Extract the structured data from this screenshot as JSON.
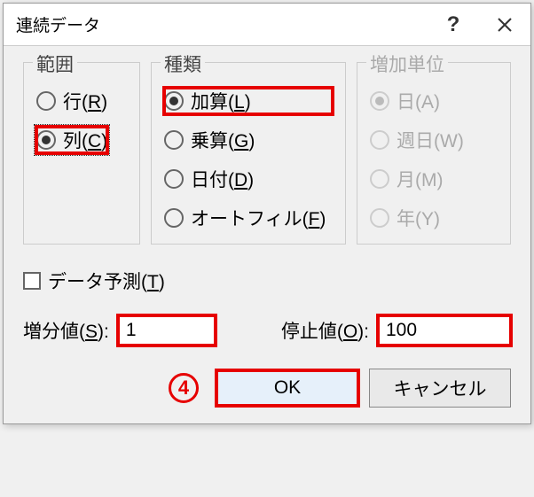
{
  "title": "連続データ",
  "help_label": "?",
  "groups": {
    "range": {
      "label": "範囲",
      "options": [
        {
          "label_pre": "行(",
          "mnemonic": "R",
          "label_post": ")",
          "selected": false
        },
        {
          "label_pre": "列(",
          "mnemonic": "C",
          "label_post": ")",
          "selected": true
        }
      ]
    },
    "type": {
      "label": "種類",
      "options": [
        {
          "label_pre": "加算(",
          "mnemonic": "L",
          "label_post": ")",
          "selected": true
        },
        {
          "label_pre": "乗算(",
          "mnemonic": "G",
          "label_post": ")",
          "selected": false
        },
        {
          "label_pre": "日付(",
          "mnemonic": "D",
          "label_post": ")",
          "selected": false
        },
        {
          "label_pre": "オートフィル(",
          "mnemonic": "F",
          "label_post": ")",
          "selected": false
        }
      ]
    },
    "unit": {
      "label": "増加単位",
      "options": [
        {
          "label_pre": "日(",
          "mnemonic": "A",
          "label_post": ")",
          "selected": true
        },
        {
          "label_pre": "週日(",
          "mnemonic": "W",
          "label_post": ")",
          "selected": false
        },
        {
          "label_pre": "月(",
          "mnemonic": "M",
          "label_post": ")",
          "selected": false
        },
        {
          "label_pre": "年(",
          "mnemonic": "Y",
          "label_post": ")",
          "selected": false
        }
      ]
    }
  },
  "trend": {
    "label_pre": "データ予測(",
    "mnemonic": "T",
    "label_post": ")",
    "checked": false
  },
  "step": {
    "label_pre": "増分値(",
    "mnemonic": "S",
    "label_post": "):",
    "value": "1"
  },
  "stop": {
    "label_pre": "停止値(",
    "mnemonic": "O",
    "label_post": "):",
    "value": "100"
  },
  "callout": "4",
  "buttons": {
    "ok": "OK",
    "cancel": "キャンセル"
  }
}
